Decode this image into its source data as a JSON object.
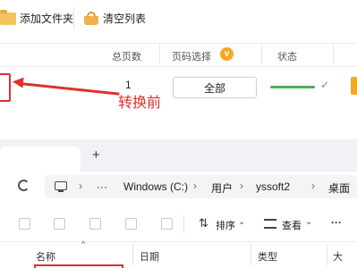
{
  "top_toolbar": {
    "add_folder_label": "添加文件夹",
    "clear_list_label": "清空列表"
  },
  "table_header": {
    "total_pages": "总页数",
    "page_select": "页码选择",
    "status": "状态",
    "badge": "v"
  },
  "row": {
    "pages_value": "1",
    "select_value": "全部",
    "status_check": "✓"
  },
  "annotation": {
    "text": "转换前",
    "color": "#e0302a"
  },
  "explorer": {
    "new_tab": "+",
    "breadcrumb": [
      "Windows (C:)",
      "用户",
      "yssoft2",
      "桌面"
    ],
    "more_label": "···",
    "sort_label": "排序",
    "view_label": "查看",
    "ellipsis": "···",
    "columns": [
      "名称",
      "日期",
      "类型",
      "大"
    ]
  },
  "colors": {
    "accent_orange": "#f5a623",
    "status_green": "#4caf50",
    "arrow_red": "#e0302a"
  }
}
